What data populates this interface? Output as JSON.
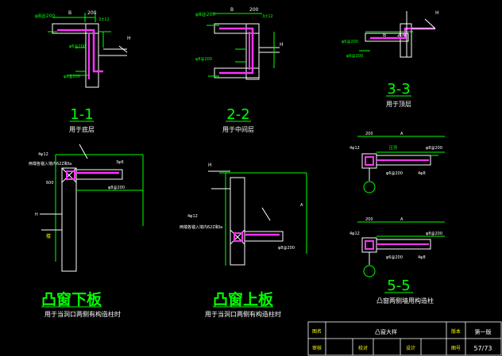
{
  "colors": {
    "background": "#000000",
    "green": "#00ff00",
    "magenta": "#ff33ff",
    "white": "#ffffff",
    "yellow": "#ffff00",
    "cyan": "#00ffff"
  },
  "sections": {
    "s1": {
      "id": "1-1",
      "caption": "用于底层"
    },
    "s2": {
      "id": "2-2",
      "caption": "用于中间层"
    },
    "s3": {
      "id": "3-3",
      "caption": "用于顶层"
    },
    "s5": {
      "id": "5-5",
      "caption": "凸窗两侧墙用构造柱"
    },
    "lower": {
      "title": "凸窗下板",
      "caption": "用于当洞口两侧有构造柱时"
    },
    "upper": {
      "title": "凸窗上板",
      "caption": "用于当洞口两侧有构造柱时"
    }
  },
  "labels": {
    "dim_B": "B",
    "dim_200": "200",
    "dim_H": "H",
    "dim_A": "A",
    "dim_600": "600",
    "rebar_3phi12": "3±12",
    "rebar_4phi12": "4φ12",
    "rebar_phi8_200": "φ8@200",
    "rebar_phi6_200": "φ6@200",
    "rebar_3phi6": "3φ6",
    "rebar_4phi8": "4φ8",
    "note_anchor": "两端各锚入墙内62Z和la",
    "note_beam": "压顶",
    "note_slab": "楼"
  },
  "title_block": {
    "label_drawing": "图名",
    "drawing_name": "凸窗大样",
    "label_version": "版本",
    "version": "第一版",
    "label_review": "审核",
    "label_check": "校对",
    "label_design": "设计",
    "label_sheet": "图号",
    "sheet": "57/73"
  }
}
